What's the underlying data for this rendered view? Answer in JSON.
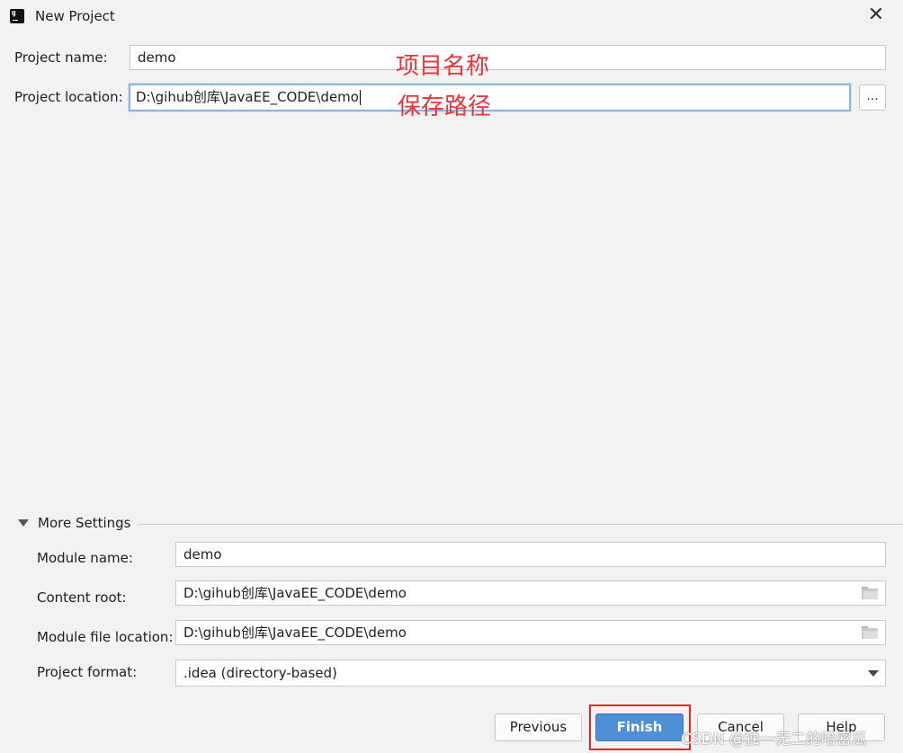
{
  "window": {
    "title": "New Project",
    "app_icon_text": "IJ"
  },
  "project": {
    "name_label": "Project name:",
    "name_value": "demo",
    "location_label": "Project location:",
    "location_value": "D:\\gihub创库\\JavaEE_CODE\\demo",
    "browse_label": "..."
  },
  "annotations": {
    "name_note": "项目名称",
    "location_note": "保存路径"
  },
  "more_settings": {
    "title": "More Settings",
    "module_name_label": "Module name:",
    "module_name_value": "demo",
    "content_root_label": "Content root:",
    "content_root_value": "D:\\gihub创库\\JavaEE_CODE\\demo",
    "module_file_label": "Module file location:",
    "module_file_value": "D:\\gihub创库\\JavaEE_CODE\\demo",
    "format_label": "Project format:",
    "format_value": ".idea (directory-based)"
  },
  "buttons": {
    "previous": "Previous",
    "finish": "Finish",
    "cancel": "Cancel",
    "help": "Help"
  },
  "watermark": "CSDN @独一无二的哈密瓜",
  "colors": {
    "primary": "#4f8fd6",
    "annotation": "#e8343a",
    "focus_border": "#8fb4e3"
  },
  "icons": [
    "intellij-idea-icon",
    "close-icon",
    "folder-icon",
    "chevron-down-icon",
    "triangle-down-icon"
  ]
}
